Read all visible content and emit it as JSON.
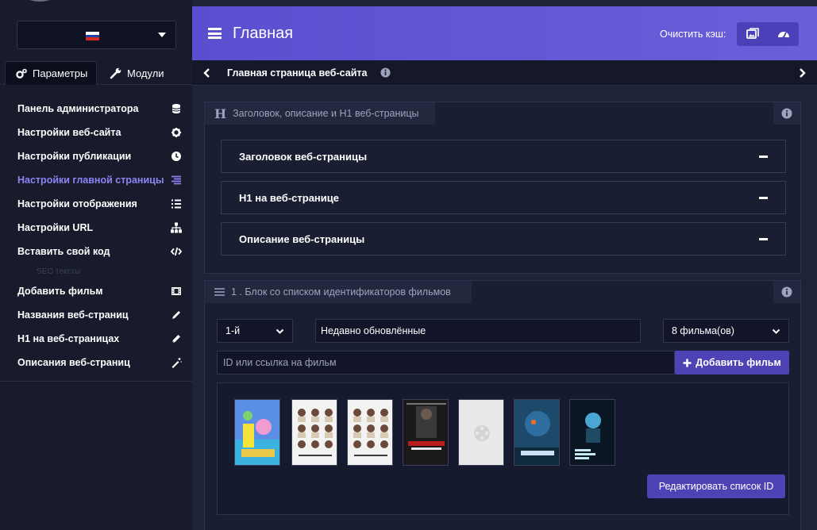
{
  "sidebar": {
    "language": {
      "selected": "RU",
      "flag_colors": [
        "#ffffff",
        "#1c3fa8",
        "#d52b1e"
      ]
    },
    "tabs": [
      {
        "label": "Параметры",
        "icon": "cogs-icon"
      },
      {
        "label": "Модули",
        "icon": "wrench-icon"
      }
    ],
    "items": [
      {
        "label": "Панель администратора",
        "icon": "database-icon"
      },
      {
        "label": "Настройки веб-сайта",
        "icon": "gear-icon"
      },
      {
        "label": "Настройки публикации",
        "icon": "clock-icon"
      },
      {
        "label": "Настройки главной страницы",
        "icon": "align-right-icon",
        "active": true
      },
      {
        "label": "Настройки отображения",
        "icon": "list-icon"
      },
      {
        "label": "Настройки URL",
        "icon": "sitemap-icon"
      },
      {
        "label": "Вставить свой код",
        "icon": "code-icon"
      }
    ],
    "separator": "SEO тексты",
    "seo_items": [
      {
        "label": "Добавить фильм",
        "icon": "film-icon"
      },
      {
        "label": "Названия веб-страниц",
        "icon": "pencil-icon"
      },
      {
        "label": "H1 на веб-страницах",
        "icon": "pen-icon"
      },
      {
        "label": "Описания веб-страниц",
        "icon": "magic-icon"
      }
    ]
  },
  "topbar": {
    "title": "Главная",
    "cache_label": "Очистить кэш:",
    "accent": "#5a4fcf"
  },
  "breadcrumb": {
    "title": "Главная страница веб-сайта"
  },
  "seo_panel": {
    "header": "Заголовок, описание и H1 веб-страницы",
    "accordions": [
      "Заголовок веб-страницы",
      "H1 на веб-странице",
      "Описание веб-страницы"
    ]
  },
  "films_panel": {
    "header": "1 . Блок со списком идентификаторов фильмов",
    "position_select": "1-й",
    "block_title": "Недавно обновлённые",
    "count_select": "8 фильма(ов)",
    "id_placeholder": "ID или ссылка на фильм",
    "add_button": "Добавить фильм",
    "edit_button": "Редактировать список ID",
    "posters": [
      {
        "name": "poster-spongebob",
        "colors": [
          "#5b8fe6",
          "#3bb2e0",
          "#e9c84a"
        ]
      },
      {
        "name": "poster-nymphomaniac-1",
        "colors": [
          "#f2f2f2",
          "#d8c9b0",
          "#6b4a3a"
        ]
      },
      {
        "name": "poster-nymphomaniac-2",
        "colors": [
          "#f2f2f2",
          "#d8c9b0",
          "#6b4a3a"
        ]
      },
      {
        "name": "poster-john-wick",
        "colors": [
          "#1a1a1a",
          "#b81c1c",
          "#e8e8e8"
        ]
      },
      {
        "name": "poster-placeholder",
        "colors": [
          "#e9e9e9",
          "#d4d4d4",
          "#c8c8c8"
        ]
      },
      {
        "name": "poster-android",
        "colors": [
          "#0f2a3d",
          "#2e6e9e",
          "#ff6a1a"
        ]
      },
      {
        "name": "poster-social-dilemma",
        "colors": [
          "#0a1722",
          "#4aa7d4",
          "#c6e6f5"
        ]
      }
    ]
  }
}
